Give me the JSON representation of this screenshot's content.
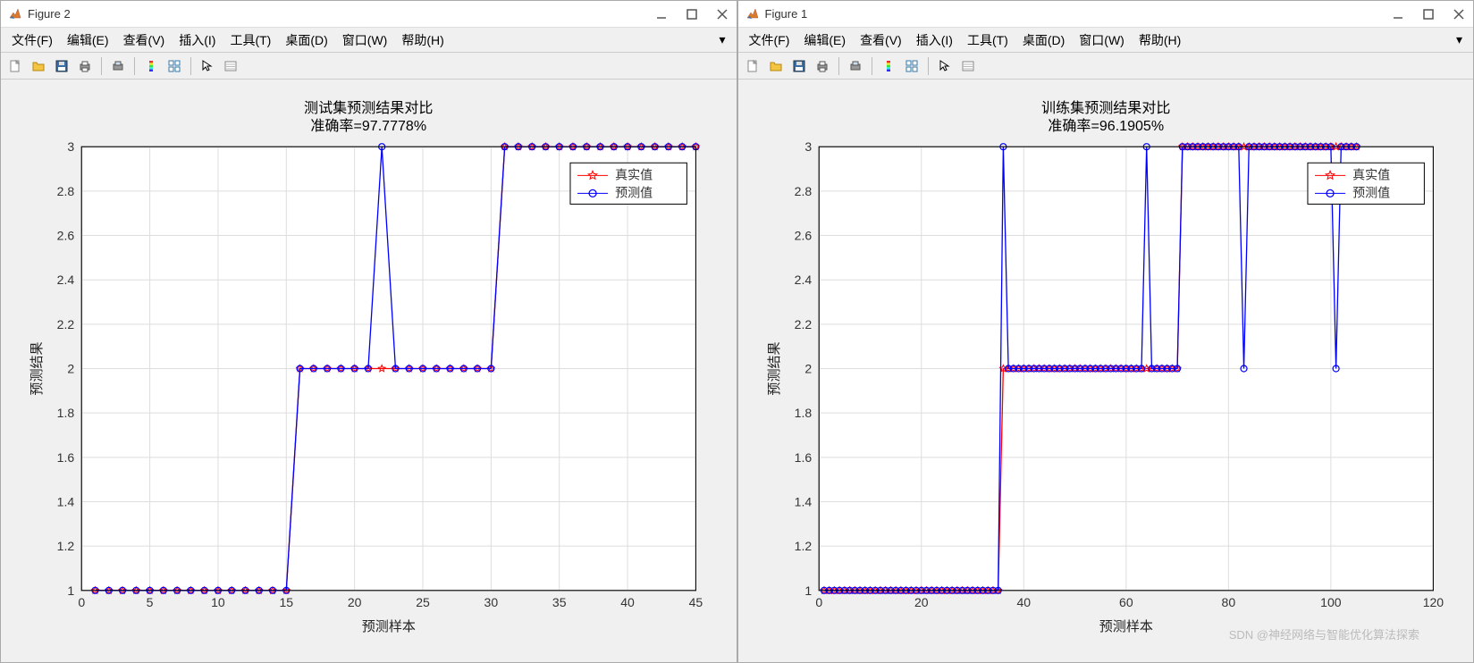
{
  "windows": [
    {
      "id": "fig2",
      "title": "Figure 2",
      "menu": [
        "文件(F)",
        "编辑(E)",
        "查看(V)",
        "插入(I)",
        "工具(T)",
        "桌面(D)",
        "窗口(W)",
        "帮助(H)"
      ]
    },
    {
      "id": "fig1",
      "title": "Figure 1",
      "menu": [
        "文件(F)",
        "编辑(E)",
        "查看(V)",
        "插入(I)",
        "工具(T)",
        "桌面(D)",
        "窗口(W)",
        "帮助(H)"
      ]
    }
  ],
  "toolbar_icons": [
    "new",
    "open",
    "save",
    "print",
    "|",
    "print-fig",
    "|",
    "colorbar",
    "linked",
    "|",
    "cursor",
    "data-inspect"
  ],
  "legend": {
    "truth": "真实值",
    "pred": "预测值"
  },
  "watermark": "SDN @神经网络与智能优化算法探索",
  "chart_data": [
    {
      "window": "fig2",
      "type": "line",
      "title": "测试集预测结果对比",
      "subtitle": "准确率=97.7778%",
      "xlabel": "预测样本",
      "ylabel": "预测结果",
      "xlim": [
        0,
        45
      ],
      "ylim": [
        1,
        3
      ],
      "xticks": [
        0,
        5,
        10,
        15,
        20,
        25,
        30,
        35,
        40,
        45
      ],
      "yticks": [
        1,
        1.2,
        1.4,
        1.6,
        1.8,
        2,
        2.2,
        2.4,
        2.6,
        2.8,
        3
      ],
      "x": [
        1,
        2,
        3,
        4,
        5,
        6,
        7,
        8,
        9,
        10,
        11,
        12,
        13,
        14,
        15,
        16,
        17,
        18,
        19,
        20,
        21,
        22,
        23,
        24,
        25,
        26,
        27,
        28,
        29,
        30,
        31,
        32,
        33,
        34,
        35,
        36,
        37,
        38,
        39,
        40,
        41,
        42,
        43,
        44,
        45
      ],
      "series": [
        {
          "name": "真实值",
          "color": "#ff0000",
          "marker": "star",
          "values": [
            1,
            1,
            1,
            1,
            1,
            1,
            1,
            1,
            1,
            1,
            1,
            1,
            1,
            1,
            1,
            2,
            2,
            2,
            2,
            2,
            2,
            2,
            2,
            2,
            2,
            2,
            2,
            2,
            2,
            2,
            3,
            3,
            3,
            3,
            3,
            3,
            3,
            3,
            3,
            3,
            3,
            3,
            3,
            3,
            3
          ]
        },
        {
          "name": "预测值",
          "color": "#0000ff",
          "marker": "circle",
          "values": [
            1,
            1,
            1,
            1,
            1,
            1,
            1,
            1,
            1,
            1,
            1,
            1,
            1,
            1,
            1,
            2,
            2,
            2,
            2,
            2,
            2,
            3,
            2,
            2,
            2,
            2,
            2,
            2,
            2,
            2,
            3,
            3,
            3,
            3,
            3,
            3,
            3,
            3,
            3,
            3,
            3,
            3,
            3,
            3,
            3
          ]
        }
      ]
    },
    {
      "window": "fig1",
      "type": "line",
      "title": "训练集预测结果对比",
      "subtitle": "准确率=96.1905%",
      "xlabel": "预测样本",
      "ylabel": "预测结果",
      "xlim": [
        0,
        120
      ],
      "ylim": [
        1,
        3
      ],
      "xticks": [
        0,
        20,
        40,
        60,
        80,
        100,
        120
      ],
      "yticks": [
        1,
        1.2,
        1.4,
        1.6,
        1.8,
        2,
        2.2,
        2.4,
        2.6,
        2.8,
        3
      ],
      "x": [
        1,
        2,
        3,
        4,
        5,
        6,
        7,
        8,
        9,
        10,
        11,
        12,
        13,
        14,
        15,
        16,
        17,
        18,
        19,
        20,
        21,
        22,
        23,
        24,
        25,
        26,
        27,
        28,
        29,
        30,
        31,
        32,
        33,
        34,
        35,
        36,
        37,
        38,
        39,
        40,
        41,
        42,
        43,
        44,
        45,
        46,
        47,
        48,
        49,
        50,
        51,
        52,
        53,
        54,
        55,
        56,
        57,
        58,
        59,
        60,
        61,
        62,
        63,
        64,
        65,
        66,
        67,
        68,
        69,
        70,
        71,
        72,
        73,
        74,
        75,
        76,
        77,
        78,
        79,
        80,
        81,
        82,
        83,
        84,
        85,
        86,
        87,
        88,
        89,
        90,
        91,
        92,
        93,
        94,
        95,
        96,
        97,
        98,
        99,
        100,
        101,
        102,
        103,
        104,
        105
      ],
      "series": [
        {
          "name": "真实值",
          "color": "#ff0000",
          "marker": "star",
          "values": [
            1,
            1,
            1,
            1,
            1,
            1,
            1,
            1,
            1,
            1,
            1,
            1,
            1,
            1,
            1,
            1,
            1,
            1,
            1,
            1,
            1,
            1,
            1,
            1,
            1,
            1,
            1,
            1,
            1,
            1,
            1,
            1,
            1,
            1,
            1,
            2,
            2,
            2,
            2,
            2,
            2,
            2,
            2,
            2,
            2,
            2,
            2,
            2,
            2,
            2,
            2,
            2,
            2,
            2,
            2,
            2,
            2,
            2,
            2,
            2,
            2,
            2,
            2,
            2,
            2,
            2,
            2,
            2,
            2,
            2,
            3,
            3,
            3,
            3,
            3,
            3,
            3,
            3,
            3,
            3,
            3,
            3,
            3,
            3,
            3,
            3,
            3,
            3,
            3,
            3,
            3,
            3,
            3,
            3,
            3,
            3,
            3,
            3,
            3,
            3,
            3,
            3,
            3,
            3,
            3
          ]
        },
        {
          "name": "预测值",
          "color": "#0000ff",
          "marker": "circle",
          "values": [
            1,
            1,
            1,
            1,
            1,
            1,
            1,
            1,
            1,
            1,
            1,
            1,
            1,
            1,
            1,
            1,
            1,
            1,
            1,
            1,
            1,
            1,
            1,
            1,
            1,
            1,
            1,
            1,
            1,
            1,
            1,
            1,
            1,
            1,
            1,
            3,
            2,
            2,
            2,
            2,
            2,
            2,
            2,
            2,
            2,
            2,
            2,
            2,
            2,
            2,
            2,
            2,
            2,
            2,
            2,
            2,
            2,
            2,
            2,
            2,
            2,
            2,
            2,
            3,
            2,
            2,
            2,
            2,
            2,
            2,
            3,
            3,
            3,
            3,
            3,
            3,
            3,
            3,
            3,
            3,
            3,
            3,
            2,
            3,
            3,
            3,
            3,
            3,
            3,
            3,
            3,
            3,
            3,
            3,
            3,
            3,
            3,
            3,
            3,
            3,
            2,
            3,
            3,
            3,
            3
          ]
        }
      ]
    }
  ]
}
